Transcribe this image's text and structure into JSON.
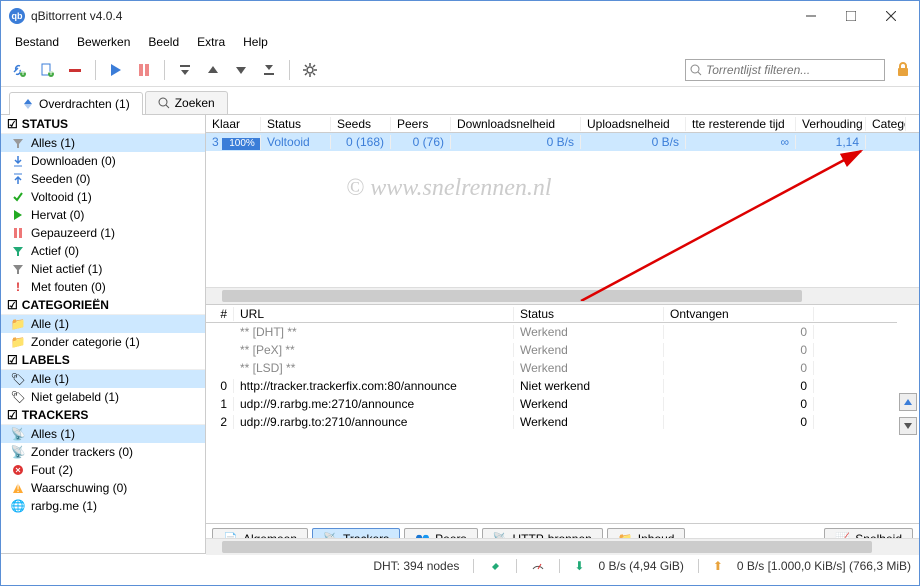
{
  "window": {
    "title": "qBittorrent v4.0.4"
  },
  "menu": [
    "Bestand",
    "Bewerken",
    "Beeld",
    "Extra",
    "Help"
  ],
  "filter_placeholder": "Torrentlijst filteren...",
  "tabs": {
    "transfers": "Overdrachten (1)",
    "search": "Zoeken"
  },
  "sidebar": {
    "status": {
      "header": "STATUS",
      "items": [
        {
          "label": "Alles (1)"
        },
        {
          "label": "Downloaden (0)"
        },
        {
          "label": "Seeden (0)"
        },
        {
          "label": "Voltooid (1)"
        },
        {
          "label": "Hervat (0)"
        },
        {
          "label": "Gepauzeerd (1)"
        },
        {
          "label": "Actief (0)"
        },
        {
          "label": "Niet actief (1)"
        },
        {
          "label": "Met fouten (0)"
        }
      ]
    },
    "categories": {
      "header": "CATEGORIEËN",
      "items": [
        {
          "label": "Alle (1)"
        },
        {
          "label": "Zonder categorie (1)"
        }
      ]
    },
    "labels": {
      "header": "LABELS",
      "items": [
        {
          "label": "Alle (1)"
        },
        {
          "label": "Niet gelabeld (1)"
        }
      ]
    },
    "trackers": {
      "header": "TRACKERS",
      "items": [
        {
          "label": "Alles (1)"
        },
        {
          "label": "Zonder trackers (0)"
        },
        {
          "label": "Fout (2)"
        },
        {
          "label": "Waarschuwing (0)"
        },
        {
          "label": "rarbg.me (1)"
        }
      ]
    }
  },
  "columns": {
    "klaar": "Klaar",
    "status": "Status",
    "seeds": "Seeds",
    "peers": "Peers",
    "dl": "Downloadsnelheid",
    "ul": "Uploadsnelheid",
    "eta": "tte resterende tijd",
    "ratio": "Verhouding",
    "cat": "Catego"
  },
  "row": {
    "progress": "100%",
    "status": "Voltooid",
    "seeds": "0 (168)",
    "peers": "0 (76)",
    "dl": "0 B/s",
    "ul": "0 B/s",
    "eta": "∞",
    "ratio": "1,14"
  },
  "tracker_cols": {
    "num": "#",
    "url": "URL",
    "status": "Status",
    "ontvangen": "Ontvangen"
  },
  "trackers_rows": [
    {
      "num": "",
      "url": "** [DHT] **",
      "status": "Werkend",
      "ont": "0",
      "muted": true
    },
    {
      "num": "",
      "url": "** [PeX] **",
      "status": "Werkend",
      "ont": "0",
      "muted": true
    },
    {
      "num": "",
      "url": "** [LSD] **",
      "status": "Werkend",
      "ont": "0",
      "muted": true
    },
    {
      "num": "0",
      "url": "http://tracker.trackerfix.com:80/announce",
      "status": "Niet werkend",
      "ont": "0"
    },
    {
      "num": "1",
      "url": "udp://9.rarbg.me:2710/announce",
      "status": "Werkend",
      "ont": "0"
    },
    {
      "num": "2",
      "url": "udp://9.rarbg.to:2710/announce",
      "status": "Werkend",
      "ont": "0"
    }
  ],
  "bottom_tabs": {
    "algemeen": "Algemeen",
    "trackers": "Trackers",
    "peers": "Peers",
    "http": "HTTP-bronnen",
    "inhoud": "Inhoud",
    "snelheid": "Snelheid"
  },
  "status_bar": {
    "dht": "DHT: 394 nodes",
    "dl": "0 B/s (4,94 GiB)",
    "ul": "0 B/s [1.000,0 KiB/s] (766,3 MiB)"
  },
  "watermark": "© www.snelrennen.nl"
}
